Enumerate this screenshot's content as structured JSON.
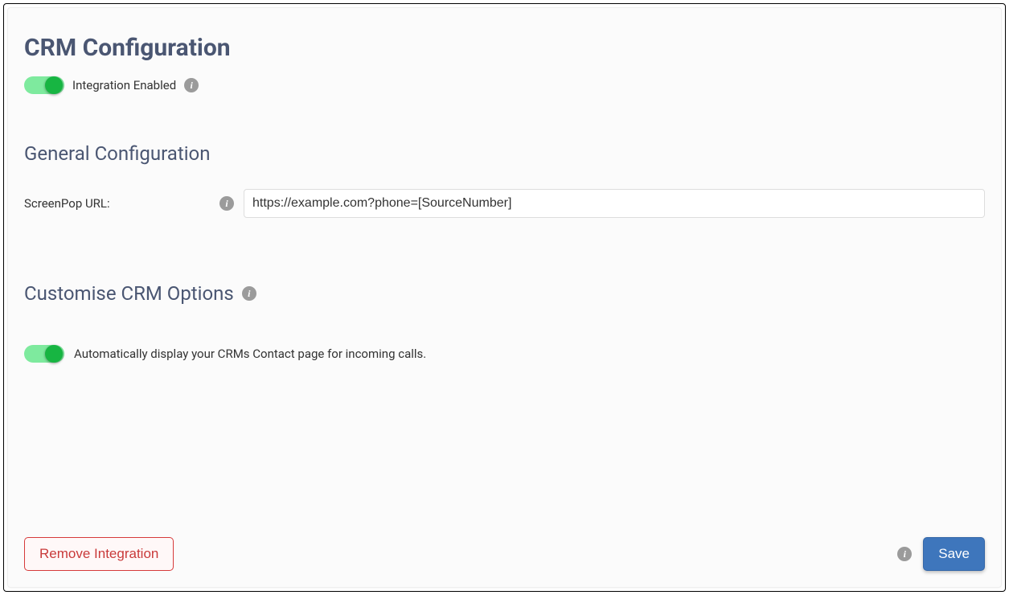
{
  "title": "CRM Configuration",
  "integration": {
    "label": "Integration Enabled",
    "enabled": true
  },
  "general": {
    "heading": "General Configuration",
    "screenpop_label": "ScreenPop URL:",
    "screenpop_value": "https://example.com?phone=[SourceNumber]"
  },
  "customise": {
    "heading": "Customise CRM Options",
    "auto_display_label": "Automatically display your CRMs Contact page for incoming calls.",
    "auto_display_enabled": true
  },
  "footer": {
    "remove_label": "Remove Integration",
    "save_label": "Save"
  }
}
